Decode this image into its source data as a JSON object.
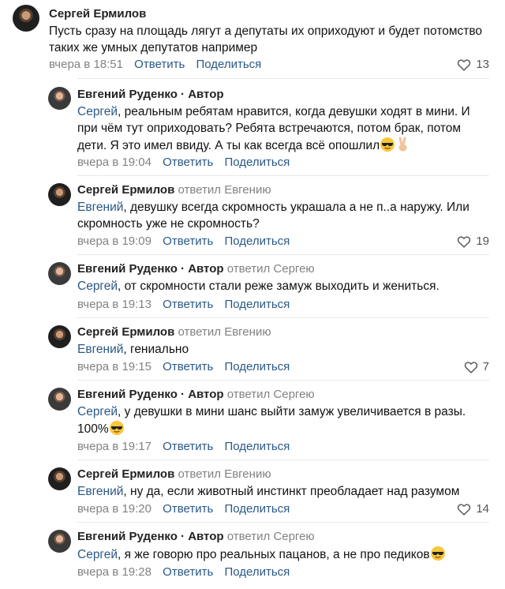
{
  "comments": [
    {
      "author": "Сергей Ермилов",
      "role": "",
      "replied": "",
      "mention": "",
      "text_l1": "Пусть сразу на площадь лягут а депутаты их оприходуют и будет потомство",
      "text_l2": "таких же умных депутатов например",
      "time": "вчера в 18:51",
      "reply": "Ответить",
      "share": "Поделиться",
      "likes": "13"
    },
    {
      "author": "Евгений Руденко",
      "sep": "·",
      "role": "Автор",
      "replied": "",
      "mention": "Сергей",
      "text_l1": ", реальным ребятам нравится, когда девушки ходят в мини. И",
      "text_l2": "при чём тут оприходовать? Ребята встречаются, потом брак, потом",
      "text_l3": "дети. Я это имел ввиду. А ты как всегда всё опошлил",
      "emoji1": "sunglasses-emoji",
      "emoji2": "victory-hand-emoji",
      "time": "вчера в 19:04",
      "reply": "Ответить",
      "share": "Поделиться",
      "likes": ""
    },
    {
      "author": "Сергей Ермилов",
      "replied": "ответил Евгению",
      "mention": "Евгений",
      "text_l1": ", девушку всегда скромность украшала а не п..а наружу. Или",
      "text_l2": "скромность уже не скромность?",
      "time": "вчера в 19:09",
      "reply": "Ответить",
      "share": "Поделиться",
      "likes": "19"
    },
    {
      "author": "Евгений Руденко",
      "sep": "·",
      "role": "Автор",
      "replied": "ответил Сергею",
      "mention": "Сергей",
      "text_l1": ", от скромности стали реже замуж выходить и жениться.",
      "time": "вчера в 19:13",
      "reply": "Ответить",
      "share": "Поделиться",
      "likes": ""
    },
    {
      "author": "Сергей Ермилов",
      "replied": "ответил Евгению",
      "mention": "Евгений",
      "text_l1": ", гениально",
      "time": "вчера в 19:15",
      "reply": "Ответить",
      "share": "Поделиться",
      "likes": "7"
    },
    {
      "author": "Евгений Руденко",
      "sep": "·",
      "role": "Автор",
      "replied": "ответил Сергею",
      "mention": "Сергей",
      "text_l1": ", у девушки в мини шанс выйти замуж увеличивается в разы.",
      "text_l2": "100%",
      "emoji1": "sunglasses-emoji",
      "time": "вчера в 19:17",
      "reply": "Ответить",
      "share": "Поделиться",
      "likes": ""
    },
    {
      "author": "Сергей Ермилов",
      "replied": "ответил Евгению",
      "mention": "Евгений",
      "text_l1": ", ну да, если животный инстинкт преобладает над разумом",
      "time": "вчера в 19:20",
      "reply": "Ответить",
      "share": "Поделиться",
      "likes": "14"
    },
    {
      "author": "Евгений Руденко",
      "sep": "·",
      "role": "Автор",
      "replied": "ответил Сергею",
      "mention": "Сергей",
      "text_l1": ", я же говорю про реальных пацанов, а не про педиков",
      "emoji1": "sunglasses-emoji",
      "time": "вчера в 19:28",
      "reply": "Ответить",
      "share": "Поделиться",
      "likes": ""
    }
  ],
  "colors": {
    "link": "#2a5885",
    "muted": "#828282",
    "divider": "#e7e8ec"
  }
}
